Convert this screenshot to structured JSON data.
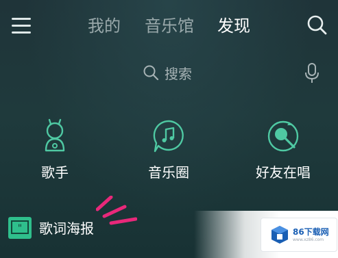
{
  "header": {
    "tabs": [
      {
        "label": "我的",
        "active": false
      },
      {
        "label": "音乐馆",
        "active": false
      },
      {
        "label": "发现",
        "active": true
      }
    ]
  },
  "search": {
    "label": "搜索"
  },
  "features": [
    {
      "label": "歌手",
      "icon": "singer-icon"
    },
    {
      "label": "音乐圈",
      "icon": "music-circle-icon"
    },
    {
      "label": "好友在唱",
      "icon": "friends-singing-icon"
    }
  ],
  "poster": {
    "label": "歌词海报",
    "icon": "lyric-poster-icon",
    "badge_color": "#2fbf8c"
  },
  "watermark": {
    "text": "86下载网",
    "sub": "www.xz86.com"
  },
  "colors": {
    "accent": "#2fbf8c",
    "icon_stroke": "#4fc9a3",
    "highlight": "#e8287a"
  }
}
